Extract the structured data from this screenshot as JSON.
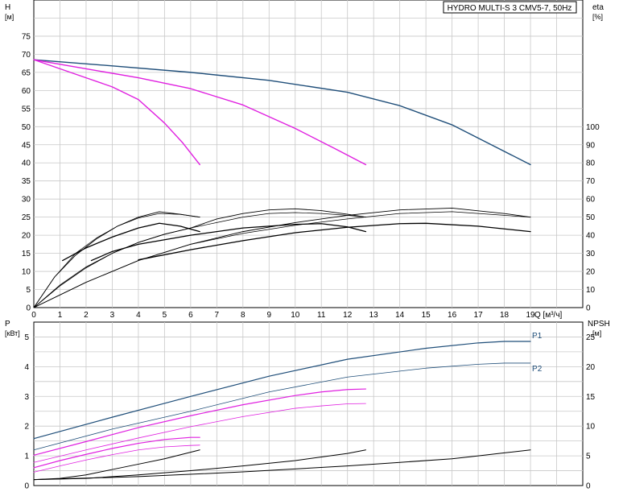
{
  "chart_data": [
    {
      "id": "top",
      "type": "line",
      "title": "HYDRO MULTI-S 3 CMV5-7, 50Hz",
      "x_axis": {
        "label": "Q [м³/ч]",
        "range": [
          0,
          21
        ],
        "ticks": [
          0,
          1,
          2,
          3,
          4,
          5,
          6,
          7,
          8,
          9,
          10,
          11,
          12,
          13,
          14,
          15,
          16,
          17,
          18,
          19
        ]
      },
      "y_left": {
        "label": "H",
        "unit": "[м]",
        "range": [
          0,
          85
        ],
        "ticks": [
          0,
          5,
          10,
          15,
          20,
          25,
          30,
          35,
          40,
          45,
          50,
          55,
          60,
          65,
          70,
          75
        ]
      },
      "y_right": {
        "label": "eta",
        "unit": "[%]",
        "range": [
          0,
          170
        ],
        "ticks": [
          0,
          10,
          20,
          30,
          40,
          50,
          60,
          70,
          80,
          90,
          100
        ]
      },
      "grid": true,
      "series": [
        {
          "axis": "left",
          "color": "#1f4e79",
          "width": 1.4,
          "points": [
            [
              0,
              68.5
            ],
            [
              3,
              66.8
            ],
            [
              6,
              65.0
            ],
            [
              9,
              62.8
            ],
            [
              12,
              59.5
            ],
            [
              14,
              55.8
            ],
            [
              16,
              50.5
            ],
            [
              17.5,
              45.0
            ],
            [
              19,
              39.5
            ]
          ]
        },
        {
          "axis": "left",
          "color": "#e020e0",
          "width": 1.4,
          "points": [
            [
              0,
              68.5
            ],
            [
              2,
              66.0
            ],
            [
              4,
              63.5
            ],
            [
              6,
              60.5
            ],
            [
              8,
              56.0
            ],
            [
              10,
              49.5
            ],
            [
              11.5,
              44.0
            ],
            [
              12.7,
              39.5
            ]
          ]
        },
        {
          "axis": "left",
          "color": "#e020e0",
          "width": 1.4,
          "points": [
            [
              0,
              68.5
            ],
            [
              1,
              66.0
            ],
            [
              2,
              63.5
            ],
            [
              3,
              61.0
            ],
            [
              4,
              57.5
            ],
            [
              5,
              51.0
            ],
            [
              5.7,
              45.5
            ],
            [
              6.35,
              39.5
            ]
          ]
        },
        {
          "axis": "right",
          "color": "#000000",
          "width": 0.7,
          "points": [
            [
              0,
              0
            ],
            [
              0.8,
              17
            ],
            [
              1.6,
              30
            ],
            [
              2.4,
              38.5
            ],
            [
              3.2,
              45
            ],
            [
              4,
              49.5
            ],
            [
              4.8,
              52
            ],
            [
              5.6,
              51.5
            ],
            [
              6.35,
              50
            ]
          ]
        },
        {
          "axis": "right",
          "color": "#000000",
          "width": 0.7,
          "points": [
            [
              0,
              0
            ],
            [
              1,
              12.5
            ],
            [
              2,
              22.5
            ],
            [
              3,
              30
            ],
            [
              4,
              36
            ],
            [
              5,
              40.5
            ],
            [
              6,
              44
            ],
            [
              7,
              47
            ],
            [
              8,
              50
            ],
            [
              9,
              52
            ],
            [
              10,
              52.5
            ],
            [
              11,
              52
            ],
            [
              12,
              51
            ],
            [
              12.7,
              50
            ]
          ]
        },
        {
          "axis": "right",
          "color": "#000000",
          "width": 0.7,
          "points": [
            [
              0,
              0
            ],
            [
              2,
              14
            ],
            [
              4,
              26
            ],
            [
              6,
              35
            ],
            [
              8,
              41
            ],
            [
              10,
              45.5
            ],
            [
              12,
              49
            ],
            [
              14,
              52
            ],
            [
              16,
              53
            ],
            [
              18,
              51
            ],
            [
              19,
              50
            ]
          ]
        },
        {
          "axis": "left",
          "color": "#000000",
          "width": 0.9,
          "points": [
            [
              0,
              0
            ],
            [
              0.8,
              8.5
            ],
            [
              1.6,
              14.5
            ],
            [
              2.4,
              19
            ],
            [
              3.2,
              22.5
            ],
            [
              4,
              25
            ],
            [
              4.8,
              26.5
            ],
            [
              5.6,
              25.8
            ],
            [
              6.35,
              25
            ]
          ]
        },
        {
          "axis": "left",
          "color": "#000000",
          "width": 0.9,
          "points": [
            [
              0,
              0
            ],
            [
              1,
              6
            ],
            [
              2,
              11
            ],
            [
              3,
              15
            ],
            [
              4,
              18
            ],
            [
              5,
              20.3
            ],
            [
              6,
              22
            ],
            [
              7,
              24.5
            ],
            [
              8,
              26
            ],
            [
              9,
              27
            ],
            [
              10,
              27.3
            ],
            [
              11,
              26.8
            ],
            [
              12,
              25.8
            ],
            [
              12.7,
              25
            ]
          ]
        },
        {
          "axis": "left",
          "color": "#000000",
          "width": 0.9,
          "points": [
            [
              0,
              0
            ],
            [
              2,
              7
            ],
            [
              4,
              13
            ],
            [
              6,
              17.5
            ],
            [
              8,
              21
            ],
            [
              10,
              23.5
            ],
            [
              12,
              25.5
            ],
            [
              14,
              27
            ],
            [
              16,
              27.5
            ],
            [
              18,
              26
            ],
            [
              19,
              25
            ]
          ]
        },
        {
          "axis": "left",
          "color": "#000000",
          "width": 1.3,
          "points": [
            [
              1.1,
              13
            ],
            [
              2,
              16.5
            ],
            [
              3,
              19.5
            ],
            [
              4,
              22
            ],
            [
              4.8,
              23.3
            ],
            [
              5.6,
              22.5
            ],
            [
              6.35,
              21
            ]
          ]
        },
        {
          "axis": "left",
          "color": "#000000",
          "width": 1.3,
          "points": [
            [
              2.2,
              13
            ],
            [
              3,
              15.5
            ],
            [
              4,
              17.5
            ],
            [
              6,
              20
            ],
            [
              8,
              22
            ],
            [
              10,
              23
            ],
            [
              11,
              23.2
            ],
            [
              12,
              22.3
            ],
            [
              12.7,
              21
            ]
          ]
        },
        {
          "axis": "left",
          "color": "#000000",
          "width": 1.3,
          "points": [
            [
              4,
              13.2
            ],
            [
              6,
              16
            ],
            [
              8,
              18.5
            ],
            [
              10,
              20.7
            ],
            [
              12,
              22.2
            ],
            [
              14,
              23.2
            ],
            [
              15,
              23.3
            ],
            [
              17,
              22.5
            ],
            [
              19,
              21
            ]
          ]
        }
      ]
    },
    {
      "id": "bottom",
      "type": "line",
      "x_axis": {
        "range": [
          0,
          21
        ]
      },
      "y_left": {
        "label": "P",
        "unit": "[кВт]",
        "range": [
          0,
          5.5
        ],
        "ticks": [
          0,
          1,
          2,
          3,
          4,
          5
        ]
      },
      "y_right": {
        "label": "NPSH",
        "unit": "[м]",
        "range": [
          0,
          27.5
        ],
        "ticks": [
          0,
          5,
          10,
          15,
          20,
          25
        ]
      },
      "grid": true,
      "labels": [
        {
          "text": "P1",
          "at": [
            19,
            4.85
          ],
          "color": "#1f4e79"
        },
        {
          "text": "P2",
          "at": [
            19,
            4.12
          ],
          "color": "#1f4e79"
        }
      ],
      "series": [
        {
          "axis": "left",
          "color": "#1f4e79",
          "width": 1.2,
          "points": [
            [
              0,
              1.58
            ],
            [
              3,
              2.3
            ],
            [
              6,
              3.0
            ],
            [
              9,
              3.68
            ],
            [
              12,
              4.25
            ],
            [
              15,
              4.62
            ],
            [
              17,
              4.8
            ],
            [
              18,
              4.85
            ],
            [
              19,
              4.85
            ]
          ]
        },
        {
          "axis": "left",
          "color": "#1f4e79",
          "width": 0.8,
          "points": [
            [
              0,
              1.2
            ],
            [
              3,
              1.9
            ],
            [
              6,
              2.5
            ],
            [
              9,
              3.15
            ],
            [
              12,
              3.65
            ],
            [
              15,
              3.95
            ],
            [
              17,
              4.08
            ],
            [
              18,
              4.12
            ],
            [
              19,
              4.12
            ]
          ]
        },
        {
          "axis": "left",
          "color": "#e020e0",
          "width": 1.2,
          "points": [
            [
              0,
              1.02
            ],
            [
              2,
              1.48
            ],
            [
              4,
              1.95
            ],
            [
              6,
              2.35
            ],
            [
              8,
              2.72
            ],
            [
              10,
              3.03
            ],
            [
              11,
              3.15
            ],
            [
              12,
              3.23
            ],
            [
              12.7,
              3.25
            ]
          ]
        },
        {
          "axis": "left",
          "color": "#e020e0",
          "width": 0.8,
          "points": [
            [
              0,
              0.78
            ],
            [
              2,
              1.2
            ],
            [
              4,
              1.6
            ],
            [
              6,
              1.98
            ],
            [
              8,
              2.32
            ],
            [
              10,
              2.6
            ],
            [
              11,
              2.68
            ],
            [
              12,
              2.75
            ],
            [
              12.7,
              2.76
            ]
          ]
        },
        {
          "axis": "left",
          "color": "#e020e0",
          "width": 1.2,
          "points": [
            [
              0,
              0.6
            ],
            [
              1,
              0.84
            ],
            [
              2,
              1.05
            ],
            [
              3,
              1.25
            ],
            [
              4,
              1.42
            ],
            [
              5,
              1.55
            ],
            [
              6,
              1.62
            ],
            [
              6.35,
              1.62
            ]
          ]
        },
        {
          "axis": "left",
          "color": "#e020e0",
          "width": 0.8,
          "points": [
            [
              0,
              0.45
            ],
            [
              1,
              0.66
            ],
            [
              2,
              0.86
            ],
            [
              3,
              1.04
            ],
            [
              4,
              1.2
            ],
            [
              5,
              1.3
            ],
            [
              6,
              1.35
            ],
            [
              6.35,
              1.36
            ]
          ]
        },
        {
          "axis": "right",
          "color": "#000000",
          "width": 1.0,
          "points": [
            [
              0,
              1.0
            ],
            [
              1,
              1.2
            ],
            [
              2,
              1.8
            ],
            [
              3,
              2.7
            ],
            [
              4,
              3.6
            ],
            [
              5,
              4.5
            ],
            [
              6.35,
              6.0
            ]
          ]
        },
        {
          "axis": "right",
          "color": "#000000",
          "width": 1.0,
          "points": [
            [
              0,
              1.0
            ],
            [
              2,
              1.2
            ],
            [
              4,
              1.8
            ],
            [
              6,
              2.5
            ],
            [
              8,
              3.3
            ],
            [
              10,
              4.2
            ],
            [
              12,
              5.4
            ],
            [
              12.7,
              6.0
            ]
          ]
        },
        {
          "axis": "right",
          "color": "#000000",
          "width": 1.0,
          "points": [
            [
              0,
              1.0
            ],
            [
              4,
              1.5
            ],
            [
              8,
              2.3
            ],
            [
              12,
              3.3
            ],
            [
              14,
              3.9
            ],
            [
              16,
              4.5
            ],
            [
              17,
              5.0
            ],
            [
              18,
              5.5
            ],
            [
              19,
              6.0
            ]
          ]
        }
      ]
    }
  ]
}
